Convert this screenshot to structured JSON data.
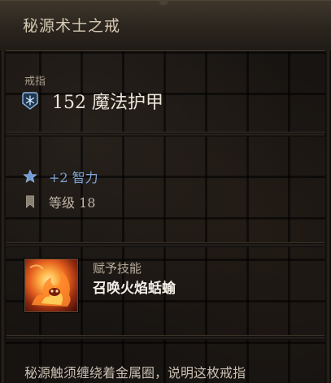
{
  "tooltip": {
    "title": "秘源术士之戒",
    "slot_type": "戒指",
    "armor": {
      "icon": "snowflake-rune-icon",
      "value_text": "152 魔法护甲",
      "color": "#8fb6e0"
    },
    "stats": [
      {
        "icon": "star-icon",
        "text": "+2 智力",
        "color": "#7fa6d8"
      },
      {
        "icon": "bookmark-icon",
        "text": "等级 18",
        "color": "#c0b6a8"
      }
    ],
    "skill": {
      "icon": "fire-slug-skill-icon",
      "grant_label": "赋予技能",
      "name": "召唤火焰蛞蝓"
    },
    "description": "秘源触须缠绕着金属圈，说明这枚戒指"
  }
}
